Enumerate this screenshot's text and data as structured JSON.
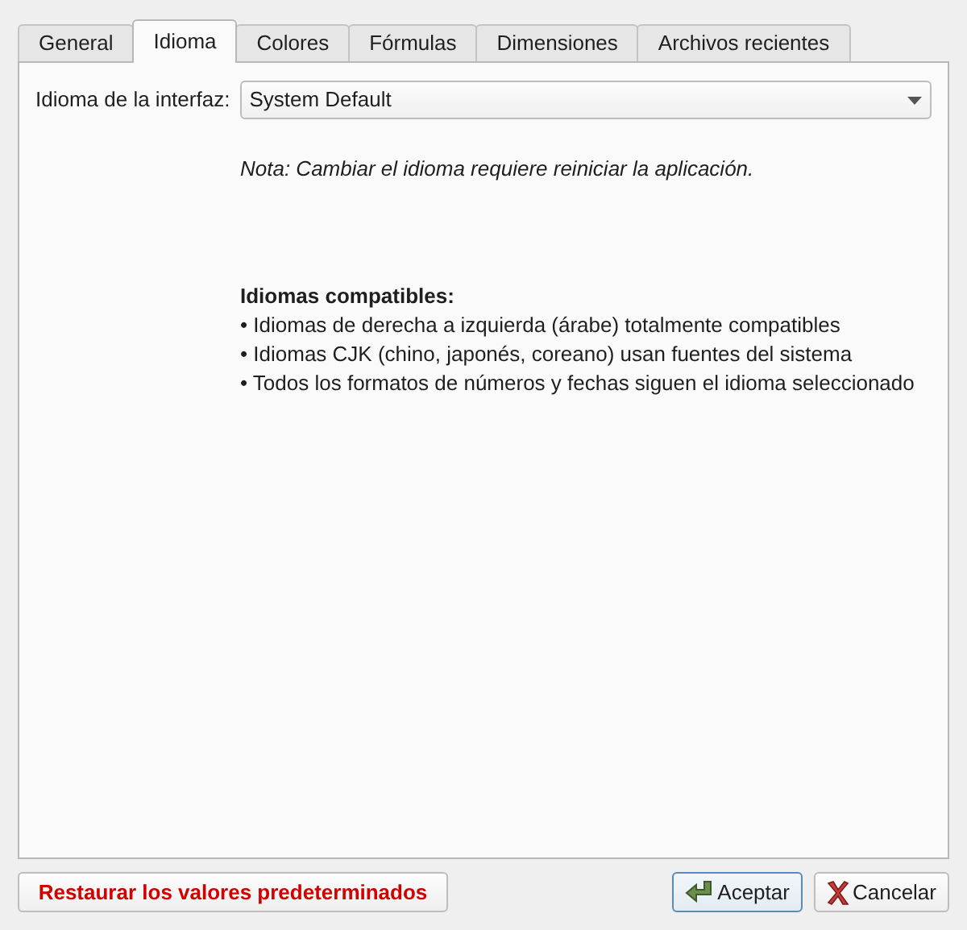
{
  "tabs": [
    {
      "label": "General",
      "selected": false
    },
    {
      "label": "Idioma",
      "selected": true
    },
    {
      "label": "Colores",
      "selected": false
    },
    {
      "label": "Fórmulas",
      "selected": false
    },
    {
      "label": "Dimensiones",
      "selected": false
    },
    {
      "label": "Archivos recientes",
      "selected": false
    }
  ],
  "language_field": {
    "label": "Idioma de la interfaz:",
    "value": "System Default"
  },
  "note": "Nota: Cambiar el idioma requiere reiniciar la aplicación.",
  "info": {
    "heading": "Idiomas compatibles:",
    "lines": [
      "• Idiomas de derecha a izquierda (árabe) totalmente compatibles",
      "• Idiomas CJK (chino, japonés, coreano) usan fuentes del sistema",
      "• Todos los formatos de números y fechas siguen el idioma seleccionado"
    ]
  },
  "reset_button": {
    "label": "Restaurar los valores predeterminados"
  },
  "buttons": [
    {
      "label": "Aceptar",
      "kind": "ok",
      "default": true
    },
    {
      "label": "Cancelar",
      "kind": "cancel",
      "default": false
    }
  ]
}
